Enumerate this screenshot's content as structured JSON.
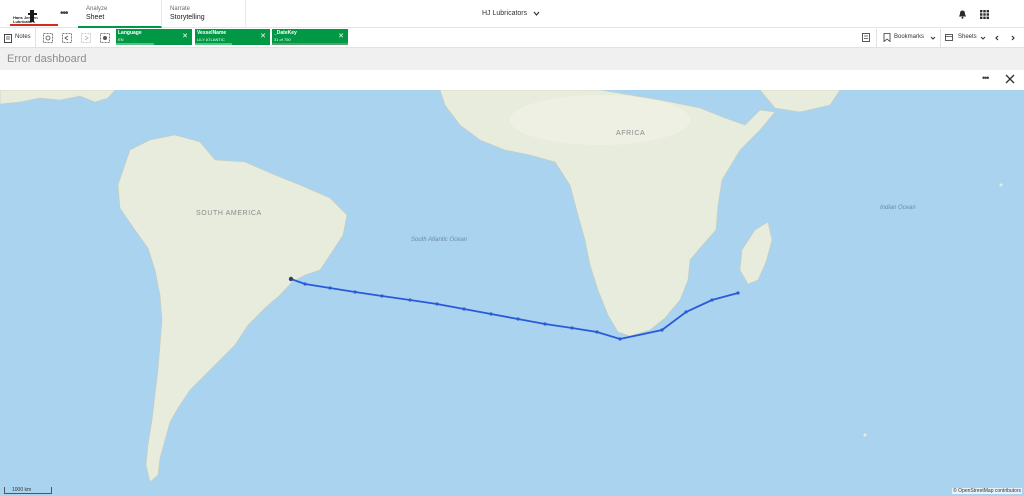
{
  "header": {
    "logo": {
      "name": "Hans Jensen Lubricators",
      "text_line1": "Hans Jensen",
      "text_line2": "Lubricators"
    },
    "tabs": [
      {
        "small": "Analyze",
        "large": "Sheet",
        "active": true
      },
      {
        "small": "Narrate",
        "large": "Storytelling",
        "active": false
      }
    ],
    "app_title": "HJ Lubricators"
  },
  "toolbar": {
    "notes_label": "Notes",
    "selections": [
      {
        "field": "Language",
        "value": "EN"
      },
      {
        "field": "VesselName",
        "value": "LILY ATLANTIC"
      },
      {
        "field": "_DateKey",
        "value": "31 of 750"
      }
    ],
    "bookmarks_label": "Bookmarks",
    "sheets_label": "Sheets"
  },
  "sheet": {
    "title": "Error dashboard"
  },
  "map": {
    "labels": {
      "south_america": "SOUTH AMERICA",
      "africa": "AFRICA",
      "south_atlantic": "South Atlantic Ocean",
      "indian_ocean": "Indian Ocean"
    },
    "scale": "1000 km",
    "attribution": "© OpenStreetMap contributors",
    "route_color": "#2a5bd7",
    "land_color": "#e8ecdd",
    "water_color": "#aad3f0"
  }
}
